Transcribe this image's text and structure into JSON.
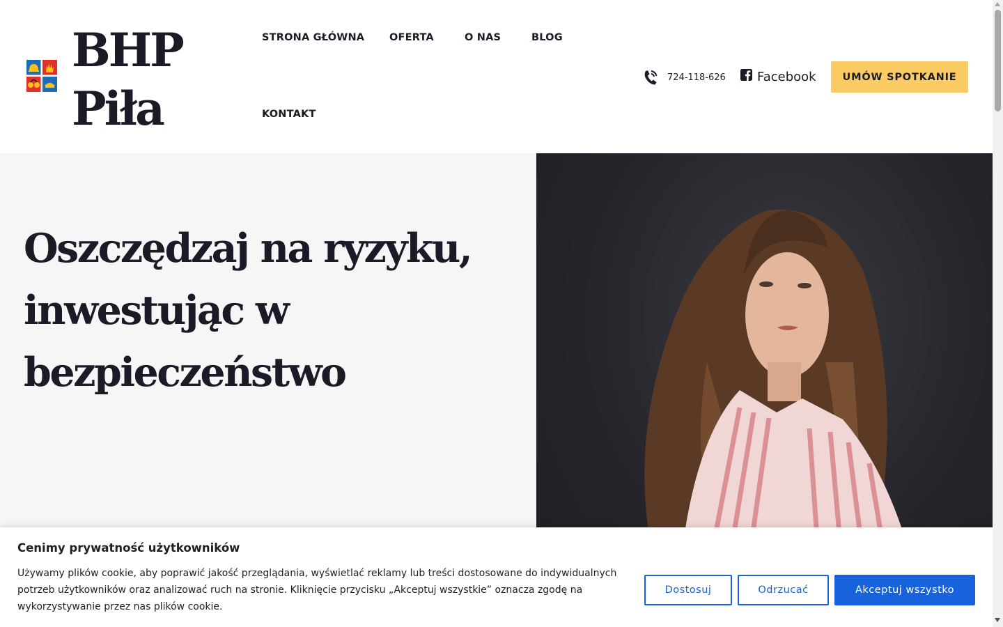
{
  "brand": {
    "name_line1": "BHP",
    "name_line2": "Piła"
  },
  "nav": {
    "items": [
      {
        "label": "STRONA GŁÓWNA"
      },
      {
        "label": "OFERTA"
      },
      {
        "label": "O NAS"
      },
      {
        "label": "BLOG"
      },
      {
        "label": "KONTAKT"
      }
    ]
  },
  "contact": {
    "phone": "724-118-626",
    "facebook_label": "Facebook"
  },
  "cta": {
    "label": "UMÓW SPOTKANIE"
  },
  "hero": {
    "headline": "Oszczędzaj na ryzyku, inwestując w bezpieczeństwo"
  },
  "cookie": {
    "title": "Cenimy prywatność użytkowników",
    "text": "Używamy plików cookie, aby poprawić jakość przeglądania, wyświetlać reklamy lub treści dostosowane do indywidualnych potrzeb użytkowników oraz analizować ruch na stronie. Kliknięcie przycisku „Akceptuj wszystkie” oznacza zgodę na wykorzystywanie przez nas plików cookie.",
    "customize_label": "Dostosuj",
    "reject_label": "Odrzucać",
    "accept_label": "Akceptuj wszystko"
  },
  "colors": {
    "accent_yellow": "#fbcb63",
    "cookie_blue": "#1863dc",
    "text_dark": "#1b1b27",
    "hero_bg": "#f6f6f7",
    "logo_blue": "#1e6cb5",
    "logo_red": "#e12f2a",
    "logo_yellow": "#f7c31a"
  },
  "icons": {
    "phone": "phone-ringing-icon",
    "facebook": "facebook-square-icon",
    "logo": "safety-equipment-logo-icon"
  }
}
